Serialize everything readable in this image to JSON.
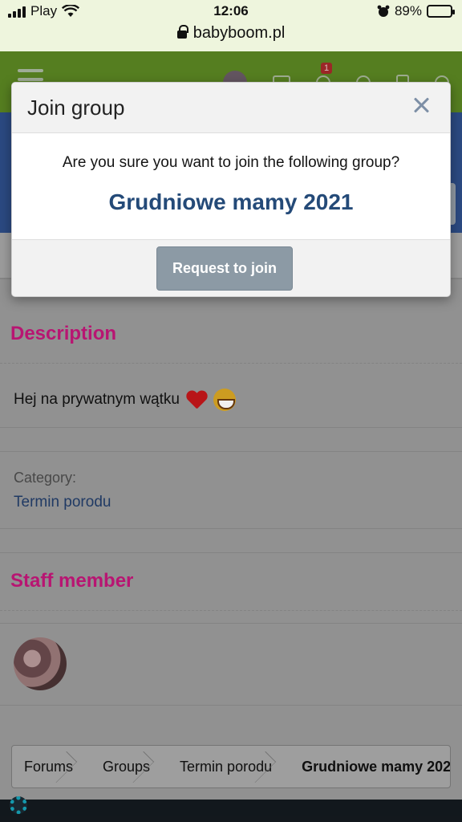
{
  "status_bar": {
    "carrier": "Play",
    "time": "12:06",
    "battery": "89%",
    "battery_level": 0.89
  },
  "browser": {
    "url": "babyboom.pl"
  },
  "site": {
    "notification_count": "1",
    "description": {
      "title": "Description",
      "text": "Hej na prywatnym wątku"
    },
    "category": {
      "label": "Category:",
      "value": "Termin porodu"
    },
    "staff": {
      "title": "Staff member"
    },
    "breadcrumb": [
      "Forums",
      "Groups",
      "Termin porodu",
      "Grudniowe mamy 202"
    ]
  },
  "modal": {
    "title": "Join group",
    "question": "Are you sure you want to join the following group?",
    "group_name": "Grudniowe mamy 2021",
    "button": "Request to join"
  },
  "colors": {
    "nav_green": "#5b8622",
    "header_blue": "#2e4e8a",
    "section_title": "#c4177a",
    "group_name": "#244a78",
    "button": "#8c9aa5"
  }
}
